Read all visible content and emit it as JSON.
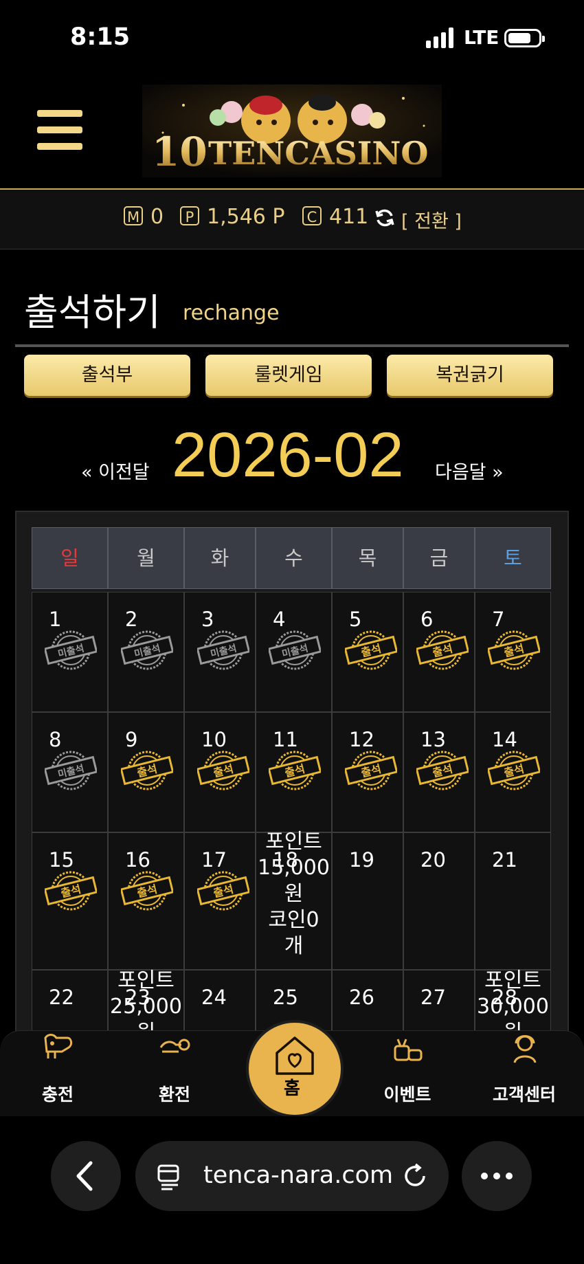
{
  "status_bar": {
    "time": "8:15",
    "network": "LTE"
  },
  "header": {
    "logo_text": "TENCASINO"
  },
  "balance": {
    "money_icon": "M",
    "money": "0",
    "point_icon": "P",
    "points": "1,546 P",
    "coin_icon": "C",
    "coins": "411",
    "switch_label": "[ 전환 ]"
  },
  "page": {
    "title": "출석하기",
    "subtitle": "rechange"
  },
  "tabs": [
    {
      "label": "출석부"
    },
    {
      "label": "룰렛게임"
    },
    {
      "label": "복권긁기"
    }
  ],
  "month_nav": {
    "prev": "« 이전달",
    "current": "2026-02",
    "next": "다음달 »"
  },
  "calendar": {
    "weekdays": [
      "일",
      "월",
      "화",
      "수",
      "목",
      "금",
      "토"
    ],
    "weekday_colors": {
      "sunday": "#e23b3b",
      "saturday": "#5aa0e0",
      "default": "#c9c9c9"
    },
    "stamp_labels": {
      "present": "출석",
      "absent": "미출석"
    },
    "weeks": [
      [
        {
          "day": "1",
          "stamp": "absent"
        },
        {
          "day": "2",
          "stamp": "absent"
        },
        {
          "day": "3",
          "stamp": "absent"
        },
        {
          "day": "4",
          "stamp": "absent"
        },
        {
          "day": "5",
          "stamp": "present"
        },
        {
          "day": "6",
          "stamp": "present"
        },
        {
          "day": "7",
          "stamp": "present"
        }
      ],
      [
        {
          "day": "8",
          "stamp": "absent"
        },
        {
          "day": "9",
          "stamp": "present"
        },
        {
          "day": "10",
          "stamp": "present"
        },
        {
          "day": "11",
          "stamp": "present"
        },
        {
          "day": "12",
          "stamp": "present"
        },
        {
          "day": "13",
          "stamp": "present"
        },
        {
          "day": "14",
          "stamp": "present"
        }
      ],
      [
        {
          "day": "15",
          "stamp": "present"
        },
        {
          "day": "16",
          "stamp": "present"
        },
        {
          "day": "17",
          "stamp": "present"
        },
        {
          "day": "18",
          "stamp": "none",
          "note": [
            "포인트",
            "15,000",
            "원",
            "코인0",
            "개"
          ]
        },
        {
          "day": "19",
          "stamp": "none"
        },
        {
          "day": "20",
          "stamp": "none"
        },
        {
          "day": "21",
          "stamp": "none"
        }
      ],
      [
        {
          "day": "22",
          "stamp": "none"
        },
        {
          "day": "23",
          "stamp": "none",
          "note": [
            "포인트",
            "25,000",
            "원"
          ]
        },
        {
          "day": "24",
          "stamp": "none"
        },
        {
          "day": "25",
          "stamp": "none"
        },
        {
          "day": "26",
          "stamp": "none"
        },
        {
          "day": "27",
          "stamp": "none"
        },
        {
          "day": "28",
          "stamp": "none",
          "note": [
            "포인트",
            "30,000",
            "원"
          ]
        }
      ]
    ]
  },
  "bottom_nav": {
    "items": [
      {
        "label": "충전",
        "icon": "charge-icon"
      },
      {
        "label": "환전",
        "icon": "exchange-icon"
      },
      {
        "label": "홈",
        "icon": "home-heart-icon"
      },
      {
        "label": "이벤트",
        "icon": "gift-icon"
      },
      {
        "label": "고객센터",
        "icon": "support-icon"
      }
    ]
  },
  "browser": {
    "url": "tenca-nara.com"
  },
  "colors": {
    "gold": "#f3cd55",
    "accent": "#e9b44e",
    "background": "#000000"
  }
}
